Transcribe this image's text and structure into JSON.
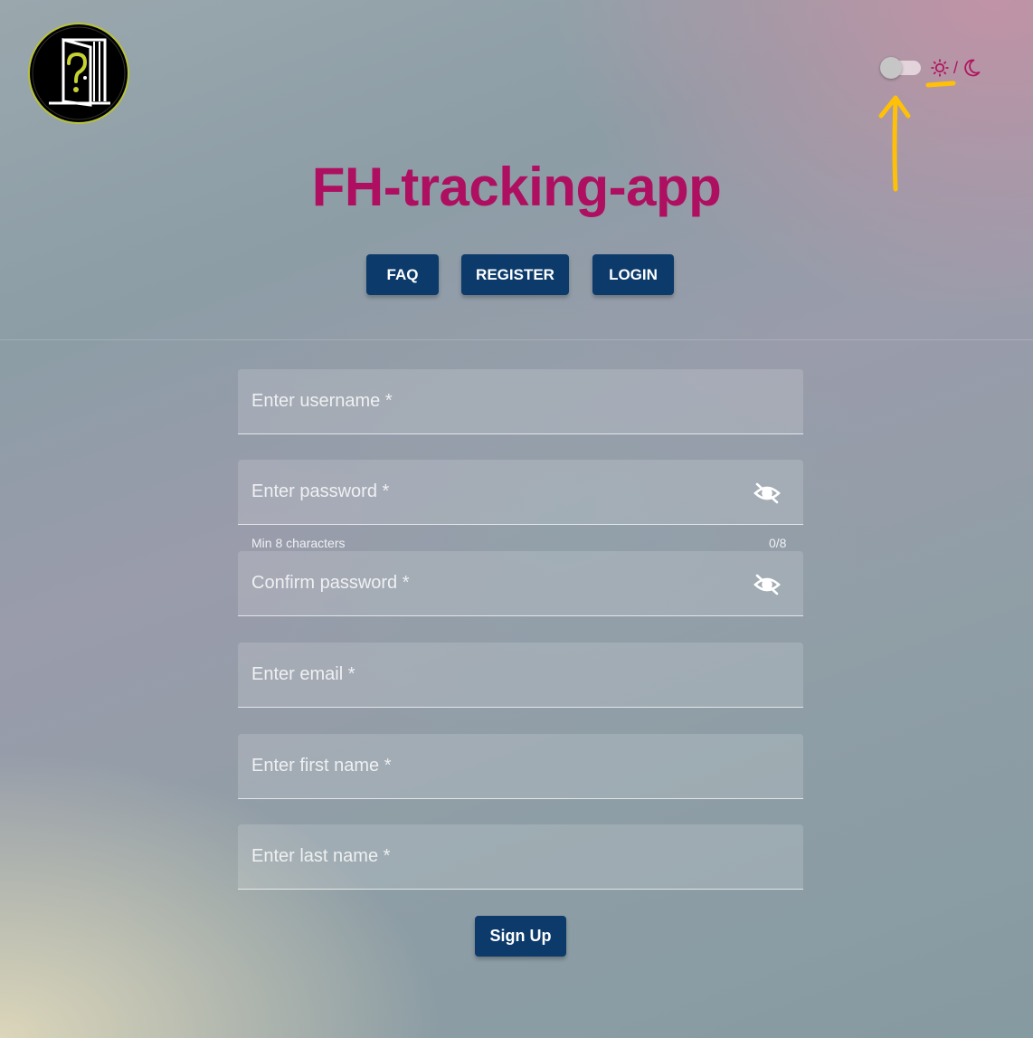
{
  "app": {
    "title": "FH-tracking-app"
  },
  "nav": {
    "faq_label": "FAQ",
    "register_label": "REGISTER",
    "login_label": "LOGIN"
  },
  "theme": {
    "separator": "/",
    "light_icon": "sun-gear-icon",
    "dark_icon": "moon-icon",
    "dark_mode_enabled": false
  },
  "form": {
    "username": {
      "placeholder": "Enter username *",
      "value": ""
    },
    "password": {
      "placeholder": "Enter password *",
      "value": "",
      "hint": "Min 8 characters",
      "counter": "0/8",
      "icon": "eye-off-icon"
    },
    "confirm_password": {
      "placeholder": "Confirm password *",
      "value": "",
      "icon": "eye-off-icon"
    },
    "email": {
      "placeholder": "Enter email *",
      "value": ""
    },
    "first_name": {
      "placeholder": "Enter first name *",
      "value": ""
    },
    "last_name": {
      "placeholder": "Enter last name *",
      "value": ""
    },
    "submit_label": "Sign Up"
  },
  "colors": {
    "brand": "#ae0f60",
    "button": "#0b3a6b",
    "annotation": "#ffc107"
  }
}
